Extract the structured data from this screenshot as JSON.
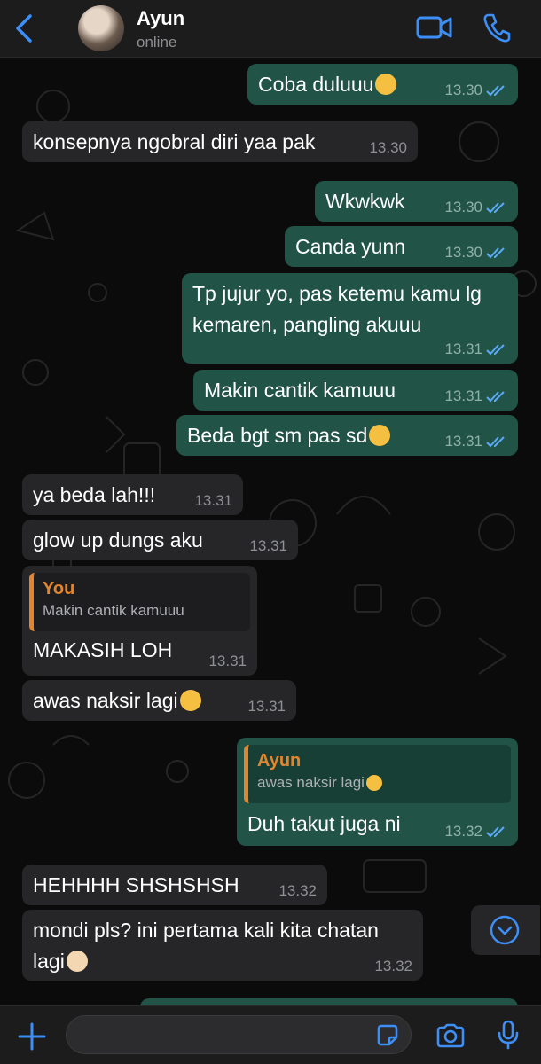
{
  "header": {
    "contact_name": "Ayun",
    "status": "online"
  },
  "messages": [
    {
      "id": "m1",
      "dir": "out",
      "text": "Coba duluuu",
      "emoji": "shushing-face-emoji",
      "time": "13.30",
      "ticks": "read"
    },
    {
      "id": "m2",
      "dir": "in",
      "text": "konsepnya ngobral diri yaa pak",
      "time": "13.30"
    },
    {
      "id": "m3",
      "dir": "out",
      "text": "Wkwkwk",
      "time": "13.30",
      "ticks": "read"
    },
    {
      "id": "m4",
      "dir": "out",
      "text": "Canda yunn",
      "time": "13.30",
      "ticks": "read"
    },
    {
      "id": "m5",
      "dir": "out",
      "text": "Tp jujur yo, pas ketemu kamu lg kemaren, pangling akuuu",
      "time": "13.31",
      "ticks": "read"
    },
    {
      "id": "m6",
      "dir": "out",
      "text": "Makin cantik kamuuu",
      "time": "13.31",
      "ticks": "read"
    },
    {
      "id": "m7",
      "dir": "out",
      "text": "Beda bgt sm pas sd",
      "emoji": "face-holding-back-tears-emoji",
      "time": "13.31",
      "ticks": "read"
    },
    {
      "id": "m8",
      "dir": "in",
      "text": "ya beda lah!!!",
      "time": "13.31"
    },
    {
      "id": "m9",
      "dir": "in",
      "text": "glow up dungs aku",
      "time": "13.31"
    },
    {
      "id": "m10",
      "dir": "in",
      "text": "MAKASIH LOH",
      "time": "13.31",
      "quote": {
        "name": "You",
        "text": "Makin cantik kamuuu"
      }
    },
    {
      "id": "m11",
      "dir": "in",
      "text": "awas naksir lagi",
      "emoji": "zany-face-emoji",
      "time": "13.31"
    },
    {
      "id": "m12",
      "dir": "out",
      "text": "Duh takut juga ni",
      "time": "13.32",
      "ticks": "read",
      "quote": {
        "name": "Ayun",
        "text": "awas naksir lagi",
        "emoji": "zany-face-emoji"
      }
    },
    {
      "id": "m13",
      "dir": "in",
      "text": "HEHHHH SHSHSHSH",
      "time": "13.32"
    },
    {
      "id": "m14",
      "dir": "in",
      "text": "mondi pls? ini pertama kali kita chatan lagi",
      "emoji": "folded-hands-emoji",
      "time": "13.32"
    }
  ],
  "composer": {
    "placeholder": ""
  },
  "colors": {
    "accent": "#3d8ef5",
    "incoming_bubble": "#262628",
    "outgoing_bubble": "#215346",
    "quote_bar": "#e2852d",
    "read_ticks": "#5aa9f8"
  },
  "icons": [
    "back-chevron-icon",
    "video-call-icon",
    "phone-call-icon",
    "scroll-down-icon",
    "plus-icon",
    "sticker-icon",
    "camera-icon",
    "microphone-icon"
  ]
}
